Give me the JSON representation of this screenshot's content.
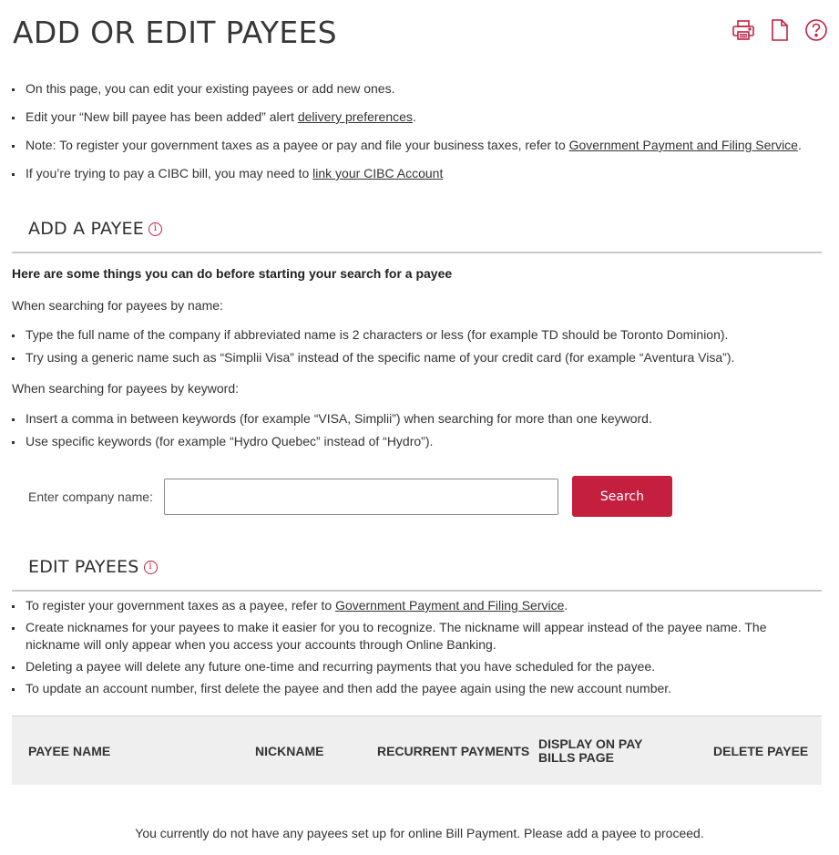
{
  "page": {
    "title": "ADD OR EDIT PAYEES"
  },
  "toolbar": {
    "icons": [
      "printer-icon",
      "document-icon",
      "help-icon"
    ],
    "accent_color": "#c41f3e"
  },
  "intro": {
    "item1": "On this page, you can edit your existing payees or add new ones.",
    "item2_prefix": "Edit your “New bill payee has been added” alert ",
    "item2_link": "delivery preferences",
    "item2_suffix": ".",
    "item3_prefix": "Note: To register your government taxes as a payee or pay and file your business taxes, refer to ",
    "item3_link": "Government Payment and Filing Service",
    "item3_suffix": ".",
    "item4_prefix": "If you’re trying to pay a CIBC bill, you may need to ",
    "item4_link": "link your CIBC Account"
  },
  "add_payee": {
    "heading": "ADD A PAYEE",
    "tips_title": "Here are some things you can do before starting your search for a payee",
    "by_name_label": "When searching for payees by name:",
    "by_name_items": [
      "Type the full name of the company if abbreviated name is 2 characters or less (for example TD should be Toronto Dominion).",
      "Try using a generic name such as “Simplii Visa” instead of the specific name of your credit card (for example “Aventura Visa”)."
    ],
    "by_keyword_label": "When searching for payees by keyword:",
    "by_keyword_items": [
      "Insert a comma in between keywords (for example “VISA, Simplii”) when searching for more than one keyword.",
      "Use specific keywords (for example “Hydro Quebec” instead of “Hydro”)."
    ],
    "search_label": "Enter company name:",
    "search_value": "",
    "search_button": "Search"
  },
  "edit_payees": {
    "heading": "EDIT PAYEES",
    "item1_prefix": "To register your government taxes as a payee, refer to ",
    "item1_link": "Government Payment and Filing Service",
    "item1_suffix": ".",
    "item2": "Create nicknames for your payees to make it easier for you to recognize. The nickname will appear instead of the payee name. The nickname will only appear when you access your accounts through Online Banking.",
    "item3": "Deleting a payee will delete any future one-time and recurring payments that you have scheduled for the payee.",
    "item4": "To update an account number, first delete the payee and then add the payee again using the new account number."
  },
  "table": {
    "columns": [
      "PAYEE NAME",
      "NICKNAME",
      "RECURRENT PAYMENTS",
      "DISPLAY ON PAY BILLS PAGE",
      "DELETE PAYEE"
    ],
    "empty_message": "You currently do not have any payees set up for online Bill Payment. Please add a payee to proceed."
  }
}
